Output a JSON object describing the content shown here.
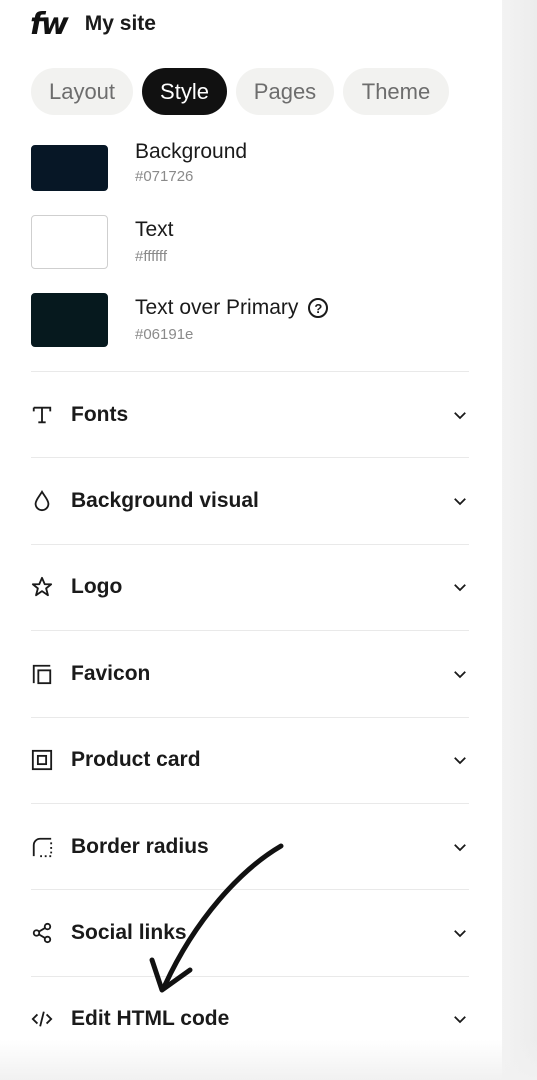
{
  "header": {
    "logo": "fw",
    "site_name": "My site"
  },
  "tabs": [
    {
      "label": "Layout",
      "active": false
    },
    {
      "label": "Style",
      "active": true
    },
    {
      "label": "Pages",
      "active": false
    },
    {
      "label": "Theme",
      "active": false
    }
  ],
  "colors": [
    {
      "label": "Background",
      "hex": "#071726"
    },
    {
      "label": "Text",
      "hex": "#ffffff"
    },
    {
      "label": "Text over Primary",
      "hex": "#06191e",
      "help_icon": "question-circle-icon"
    }
  ],
  "sections": [
    {
      "label": "Fonts",
      "icon": "type-icon"
    },
    {
      "label": "Background visual",
      "icon": "drop-icon"
    },
    {
      "label": "Logo",
      "icon": "star-icon"
    },
    {
      "label": "Favicon",
      "icon": "favicon-icon"
    },
    {
      "label": "Product card",
      "icon": "product-card-icon"
    },
    {
      "label": "Border radius",
      "icon": "border-radius-icon"
    },
    {
      "label": "Social links",
      "icon": "share-icon"
    },
    {
      "label": "Edit HTML code",
      "icon": "code-icon"
    }
  ]
}
